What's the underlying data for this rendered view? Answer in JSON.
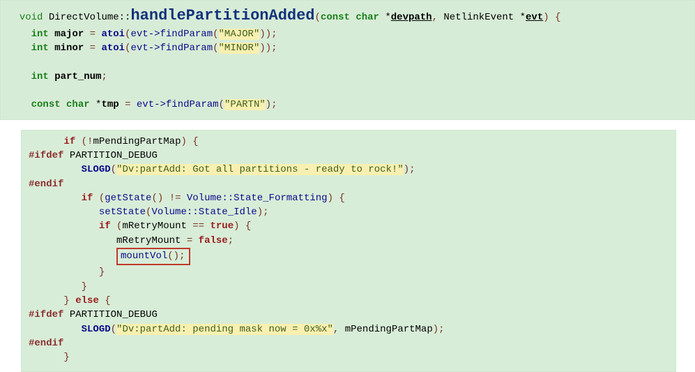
{
  "code1": {
    "kw_void": "void",
    "class_name": "DirectVolume",
    "func_name": "handlePartitionAdded",
    "kw_const": "const",
    "kw_char": "char",
    "param1_star": "*",
    "param1_name": "devpath",
    "comma": ",",
    "nlevt_type": "NetlinkEvent",
    "param2_star": "*",
    "param2_name": "evt",
    "lbrace": "{",
    "kw_int": "int",
    "var_major": "major",
    "eq": "=",
    "atoi": "atoi",
    "paren_l": "(",
    "paren_r": ")",
    "evtptr": "evt->",
    "findParam": "findParam",
    "str_major": "\"MAJOR\"",
    "semi": ";",
    "var_minor": "minor",
    "str_minor": "\"MINOR\"",
    "var_partnum": "part_num",
    "var_tmp": "tmp",
    "str_partn": "\"PARTN\""
  },
  "code2": {
    "kw_if": "if",
    "bang": "!",
    "mPending": "mPendingPartMap",
    "pre_ifdef": "#ifdef",
    "pdebug": "PARTITION_DEBUG",
    "slogd": "SLOGD",
    "str1": "\"Dv:partAdd: Got all partitions - ready to rock!\"",
    "pre_endif": "#endif",
    "getState": "getState",
    "ne": "!=",
    "volume": "Volume",
    "dcolon": "::",
    "state_format": "State_Formatting",
    "setState": "setState",
    "state_idle": "State_Idle",
    "mRetry": "mRetryMount",
    "eqeq": "==",
    "kw_true": "true",
    "eq": "=",
    "kw_false": "false",
    "mountVol": "mountVol",
    "kw_else": "else",
    "str2": "\"Dv:partAdd: pending mask now = 0x%x\"",
    "comma": ",",
    "lbrace": "{",
    "rbrace": "}",
    "paren_l": "(",
    "paren_r": ")",
    "semi": ";"
  }
}
